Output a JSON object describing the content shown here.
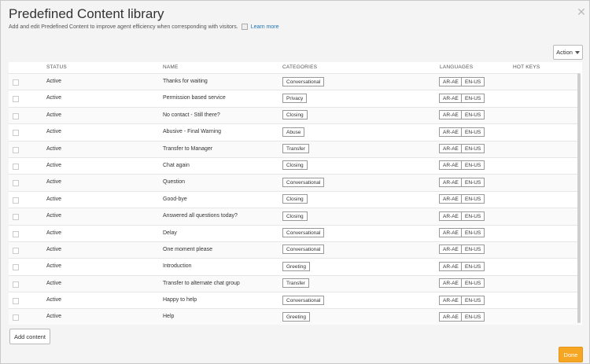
{
  "header": {
    "title": "Predefined Content library",
    "subtitle": "Add and edit Predefined Content to improve agent efficiency when corresponding with visitors.",
    "learn_more": "Learn more",
    "close_symbol": "✕"
  },
  "toolbar": {
    "action_label": "Action"
  },
  "table": {
    "columns": {
      "status": "STATUS",
      "name": "NAME",
      "categories": "CATEGORIES",
      "languages": "LANGUAGES",
      "hotkeys": "HOT KEYS"
    },
    "rows": [
      {
        "status": "Active",
        "name": "Thanks for waiting",
        "category": "Conversational",
        "lang1": "AR-AE",
        "lang2": "EN-US"
      },
      {
        "status": "Active",
        "name": "Permission based service",
        "category": "Privacy",
        "lang1": "AR-AE",
        "lang2": "EN-US"
      },
      {
        "status": "Active",
        "name": "No contact - Still there?",
        "category": "Closing",
        "lang1": "AR-AE",
        "lang2": "EN-US"
      },
      {
        "status": "Active",
        "name": "Abusive - Final Warning",
        "category": "Abuse",
        "lang1": "AR-AE",
        "lang2": "EN-US"
      },
      {
        "status": "Active",
        "name": "Transfer to Manager",
        "category": "Transfer",
        "lang1": "AR-AE",
        "lang2": "EN-US"
      },
      {
        "status": "Active",
        "name": "Chat again",
        "category": "Closing",
        "lang1": "AR-AE",
        "lang2": "EN-US"
      },
      {
        "status": "Active",
        "name": "Question",
        "category": "Conversational",
        "lang1": "AR-AE",
        "lang2": "EN-US"
      },
      {
        "status": "Active",
        "name": "Good-bye",
        "category": "Closing",
        "lang1": "AR-AE",
        "lang2": "EN-US"
      },
      {
        "status": "Active",
        "name": "Answered all questions today?",
        "category": "Closing",
        "lang1": "AR-AE",
        "lang2": "EN-US"
      },
      {
        "status": "Active",
        "name": "Delay",
        "category": "Conversational",
        "lang1": "AR-AE",
        "lang2": "EN-US"
      },
      {
        "status": "Active",
        "name": "One moment please",
        "category": "Conversational",
        "lang1": "AR-AE",
        "lang2": "EN-US"
      },
      {
        "status": "Active",
        "name": "Introduction",
        "category": "Greeting",
        "lang1": "AR-AE",
        "lang2": "EN-US"
      },
      {
        "status": "Active",
        "name": "Transfer to alternate chat group",
        "category": "Transfer",
        "lang1": "AR-AE",
        "lang2": "EN-US"
      },
      {
        "status": "Active",
        "name": "Happy to help",
        "category": "Conversational",
        "lang1": "AR-AE",
        "lang2": "EN-US"
      },
      {
        "status": "Active",
        "name": "Help",
        "category": "Greeting",
        "lang1": "AR-AE",
        "lang2": "EN-US"
      }
    ]
  },
  "footer": {
    "add_label": "Add content",
    "done_label": "Done"
  },
  "colors": {
    "accent": "#f5a623",
    "link": "#1f73b7"
  }
}
